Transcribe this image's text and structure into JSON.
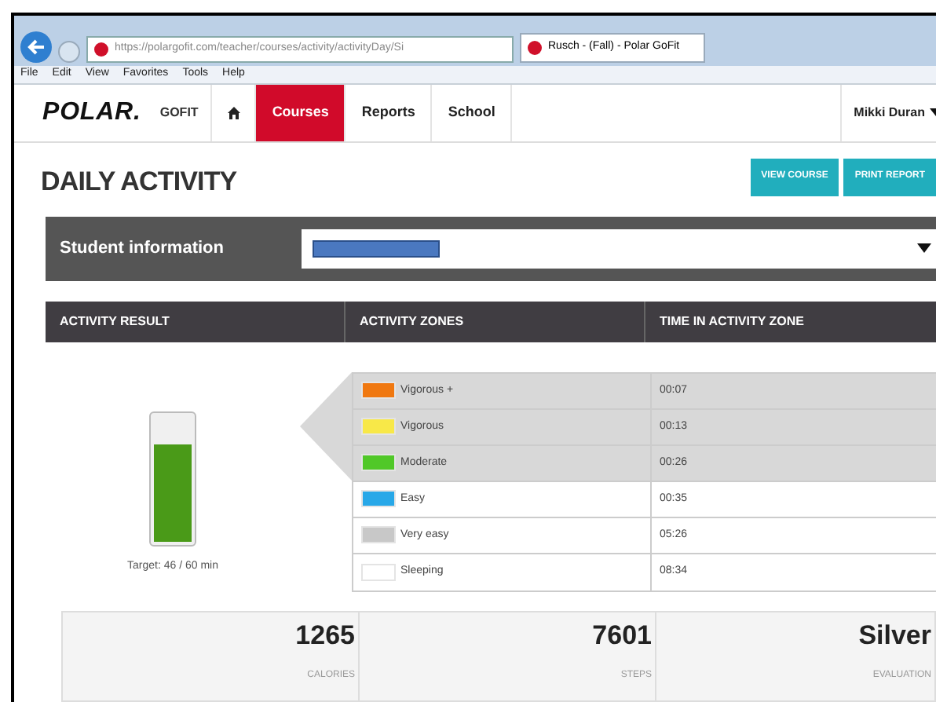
{
  "browser": {
    "url": "https://polargofit.com/teacher/courses/activity/activityDay/Si",
    "tab": "Rusch - (Fall) - Polar GoFit",
    "menu": [
      "File",
      "Edit",
      "View",
      "Favorites",
      "Tools",
      "Help"
    ]
  },
  "nav": {
    "logo": "POLAR.",
    "product": "GOFIT",
    "items": [
      {
        "label": "Courses",
        "selected": true
      },
      {
        "label": "Reports",
        "selected": false
      },
      {
        "label": "School",
        "selected": false
      }
    ],
    "user": "Mikki Duran"
  },
  "page": {
    "title": "DAILY ACTIVITY",
    "buttons": [
      "VIEW COURSE",
      "PRINT REPORT"
    ]
  },
  "student": {
    "label": "Student information"
  },
  "table": {
    "columns": [
      "ACTIVITY RESULT",
      "ACTIVITY ZONES",
      "TIME IN ACTIVITY ZONE"
    ],
    "meter": {
      "level": 0.77,
      "caption": "Target: 46 / 60 min"
    },
    "zones": [
      {
        "name": "Vigorous +",
        "color": "#f07810",
        "time": "00:07",
        "highlighted": true
      },
      {
        "name": "Vigorous",
        "color": "#f8e848",
        "time": "00:13",
        "highlighted": true
      },
      {
        "name": "Moderate",
        "color": "#50c828",
        "time": "00:26",
        "highlighted": true
      },
      {
        "name": "Easy",
        "color": "#28a8e8",
        "time": "00:35",
        "highlighted": false
      },
      {
        "name": "Very easy",
        "color": "#c8c8c8",
        "time": "05:26",
        "highlighted": false
      },
      {
        "name": "Sleeping",
        "color": "#ffffff",
        "time": "08:34",
        "highlighted": false
      }
    ]
  },
  "stats": [
    {
      "value": "1265",
      "label": "CALORIES"
    },
    {
      "value": "7601",
      "label": "STEPS"
    },
    {
      "value": "Silver",
      "label": "EVALUATION"
    }
  ]
}
